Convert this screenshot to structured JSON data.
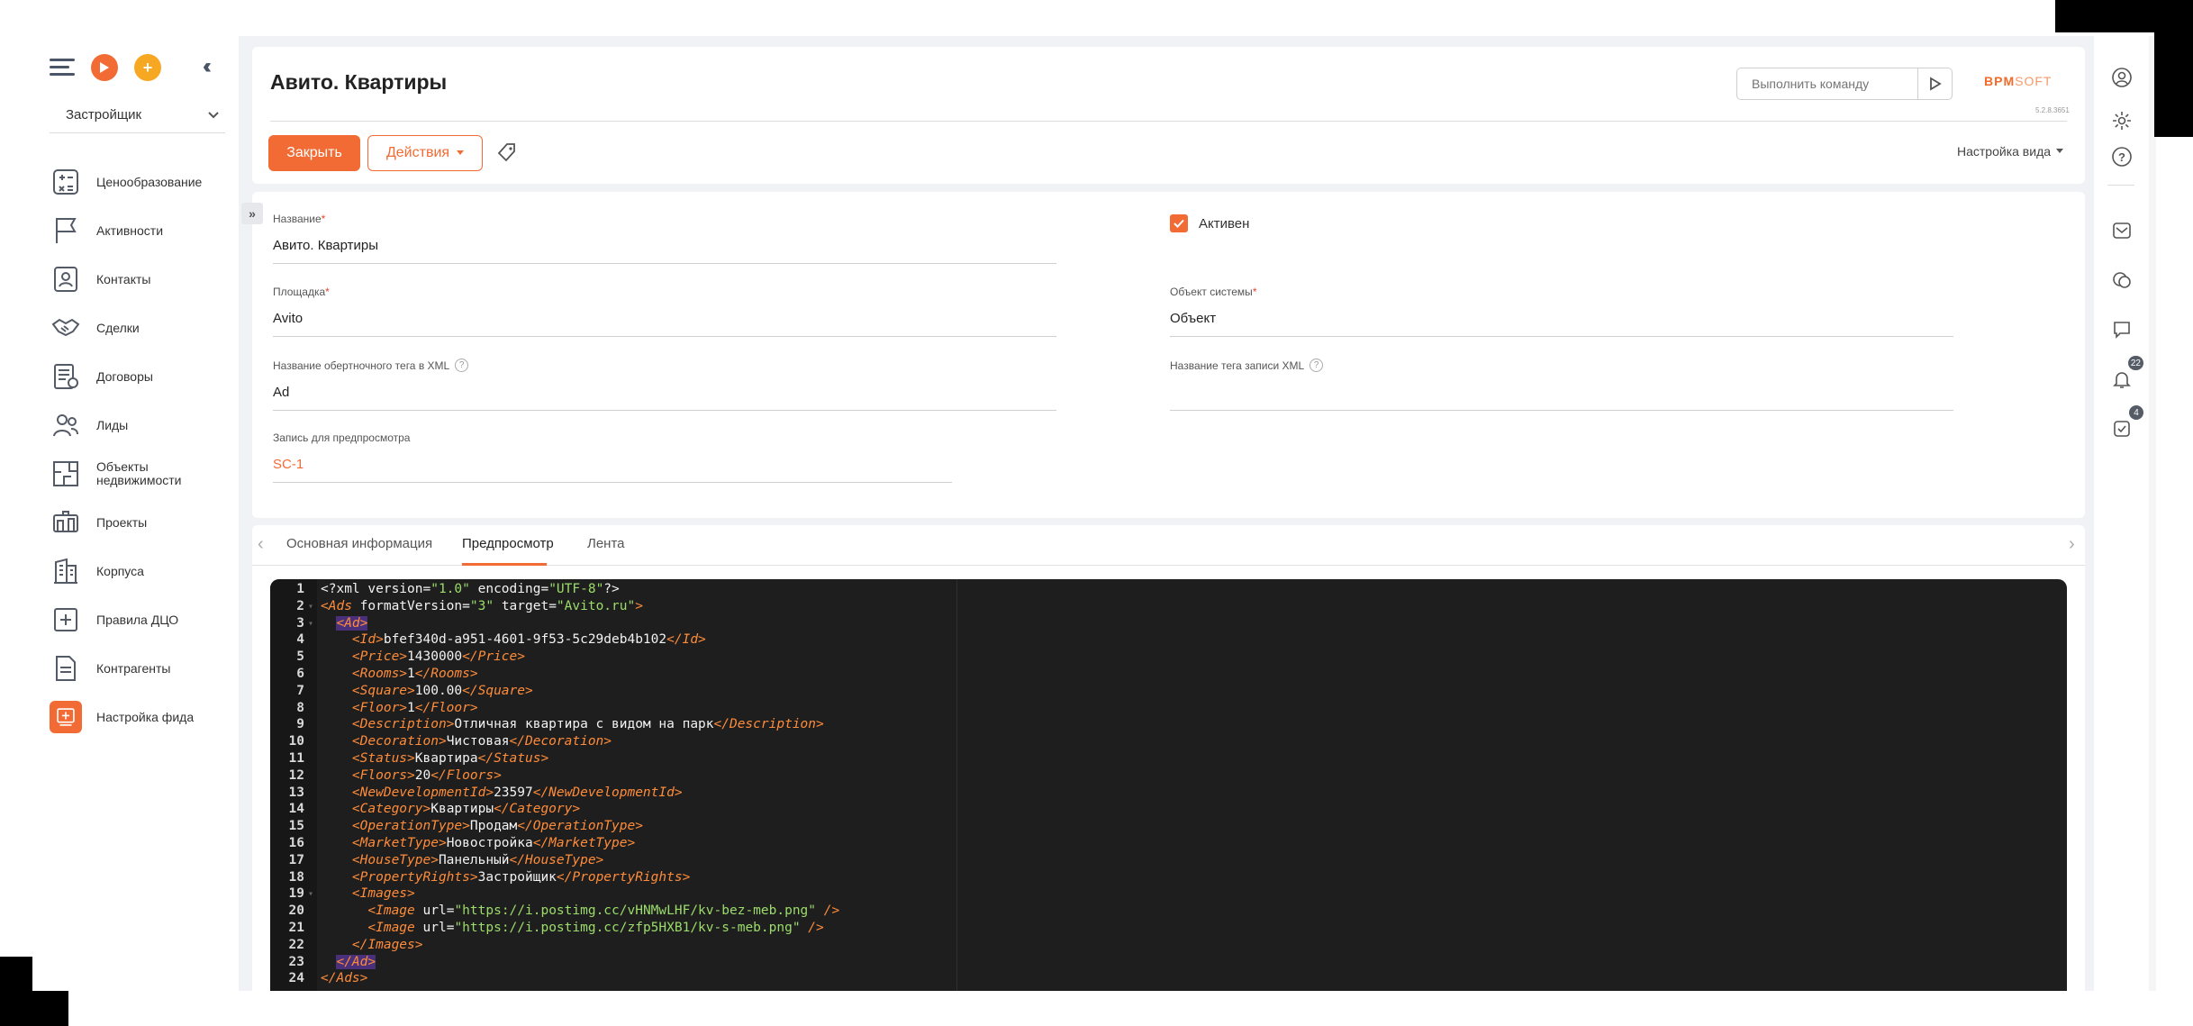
{
  "sidebar": {
    "section_select": "Застройщик",
    "items": [
      {
        "label": "Ценообразование",
        "icon": "calculator-icon"
      },
      {
        "label": "Активности",
        "icon": "flag-icon"
      },
      {
        "label": "Контакты",
        "icon": "contact-card-icon"
      },
      {
        "label": "Сделки",
        "icon": "handshake-icon"
      },
      {
        "label": "Договоры",
        "icon": "contract-icon"
      },
      {
        "label": "Лиды",
        "icon": "leads-icon"
      },
      {
        "label": "Объекты недвижимости",
        "icon": "floorplan-icon"
      },
      {
        "label": "Проекты",
        "icon": "projects-icon"
      },
      {
        "label": "Корпуса",
        "icon": "building-icon"
      },
      {
        "label": "Правила ДЦО",
        "icon": "rules-icon"
      },
      {
        "label": "Контрагенты",
        "icon": "document-icon"
      },
      {
        "label": "Настройка фида",
        "icon": "feed-settings-icon"
      }
    ]
  },
  "header": {
    "title": "Авито. Квартиры",
    "command_placeholder": "Выполнить команду",
    "brand_main": "BPM",
    "brand_sub": "SOFT",
    "version": "5.2.8.3651",
    "close_label": "Закрыть",
    "actions_label": "Действия",
    "view_settings_label": "Настройка вида"
  },
  "form": {
    "name_label": "Название",
    "name_value": "Авито. Квартиры",
    "active_label": "Активен",
    "platform_label": "Площадка",
    "platform_value": "Avito",
    "system_object_label": "Объект системы",
    "system_object_value": "Объект",
    "wrapper_tag_label": "Название обертночного тега в XML",
    "wrapper_tag_value": "Ad",
    "record_tag_label": "Название тега записи XML",
    "record_tag_value": "",
    "preview_record_label": "Запись для предпросмотра",
    "preview_record_value": "SC-1",
    "required_mark": "*"
  },
  "tabs": {
    "items": [
      "Основная информация",
      "Предпросмотр",
      "Лента"
    ],
    "active": "Предпросмотр"
  },
  "editor": {
    "lines": [
      "<?xml version=\"1.0\" encoding=\"UTF-8\"?>",
      "<Ads formatVersion=\"3\" target=\"Avito.ru\">",
      "  <Ad>",
      "    <Id>bfef340d-a951-4601-9f53-5c29deb4b102</Id>",
      "    <Price>1430000</Price>",
      "    <Rooms>1</Rooms>",
      "    <Square>100.00</Square>",
      "    <Floor>1</Floor>",
      "    <Description>Отличная квартира с видом на парк</Description>",
      "    <Decoration>Чистовая</Decoration>",
      "    <Status>Квартира</Status>",
      "    <Floors>20</Floors>",
      "    <NewDevelopmentId>23597</NewDevelopmentId>",
      "    <Category>Квартиры</Category>",
      "    <OperationType>Продам</OperationType>",
      "    <MarketType>Новостройка</MarketType>",
      "    <HouseType>Панельный</HouseType>",
      "    <PropertyRights>Застройщик</PropertyRights>",
      "    <Images>",
      "      <Image url=\"https://i.postimg.cc/vHNMwLHF/kv-bez-meb.png\" />",
      "      <Image url=\"https://i.postimg.cc/zfp5HXB1/kv-s-meb.png\" />",
      "    </Images>",
      "  </Ad>",
      "</Ads>"
    ]
  },
  "rightbar": {
    "notifications_count": "22",
    "tasks_count": "4"
  },
  "colors": {
    "accent": "#f26b35",
    "editor_bg": "#1e1e1e",
    "tag": "#ff8c3a",
    "string": "#9bdc6a"
  }
}
